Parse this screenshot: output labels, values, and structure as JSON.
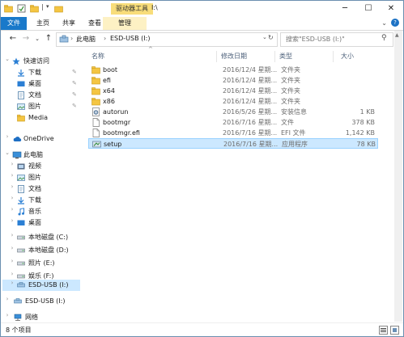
{
  "titlebar": {
    "context_tab": "驱动器工具",
    "title": "I:\\",
    "minimize": "─",
    "maximize": "☐",
    "close": "✕"
  },
  "ribbon": {
    "tabs": [
      {
        "label": "文件"
      },
      {
        "label": "主页"
      },
      {
        "label": "共享"
      },
      {
        "label": "查看"
      },
      {
        "label": "管理"
      }
    ],
    "help": "?"
  },
  "address": {
    "breadcrumb": [
      "此电脑",
      "ESD-USB (I:)"
    ],
    "separator": "›"
  },
  "search": {
    "placeholder": "搜索\"ESD-USB (I:)\""
  },
  "columns": {
    "name": "名称",
    "date": "修改日期",
    "type": "类型",
    "size": "大小"
  },
  "files": [
    {
      "name": "boot",
      "date": "2016/12/4 星期...",
      "type": "文件夹",
      "size": "",
      "icon": "folder-icon"
    },
    {
      "name": "efi",
      "date": "2016/12/4 星期...",
      "type": "文件夹",
      "size": "",
      "icon": "folder-icon"
    },
    {
      "name": "x64",
      "date": "2016/12/4 星期...",
      "type": "文件夹",
      "size": "",
      "icon": "folder-icon"
    },
    {
      "name": "x86",
      "date": "2016/12/4 星期...",
      "type": "文件夹",
      "size": "",
      "icon": "folder-icon"
    },
    {
      "name": "autorun",
      "date": "2016/5/26 星期...",
      "type": "安装信息",
      "size": "1 KB",
      "icon": "setup-info-icon"
    },
    {
      "name": "bootmgr",
      "date": "2016/7/16 星期...",
      "type": "文件",
      "size": "378 KB",
      "icon": "file-icon"
    },
    {
      "name": "bootmgr.efi",
      "date": "2016/7/16 星期...",
      "type": "EFI 文件",
      "size": "1,142 KB",
      "icon": "file-icon"
    },
    {
      "name": "setup",
      "date": "2016/7/16 星期...",
      "type": "应用程序",
      "size": "78 KB",
      "icon": "setup-app-icon"
    }
  ],
  "nav": {
    "quick_access": "快速访问",
    "quick_items": [
      "下载",
      "桌面",
      "文档",
      "图片",
      "Media"
    ],
    "onedrive": "OneDrive",
    "this_pc": "此电脑",
    "pc_items": [
      "视频",
      "图片",
      "文档",
      "下载",
      "音乐",
      "桌面",
      "本地磁盘 (C:)",
      "本地磁盘 (D:)",
      "照片 (E:)",
      "娱乐 (F:)",
      "ESD-USB (I:)"
    ],
    "esd_usb": "ESD-USB (I:)",
    "network": "网络"
  },
  "status": {
    "count": "8 个项目"
  },
  "colors": {
    "accent": "#1979ca",
    "selection": "#cce8ff",
    "folder": "#f4c542",
    "context_tab": "#f8dd7a"
  }
}
